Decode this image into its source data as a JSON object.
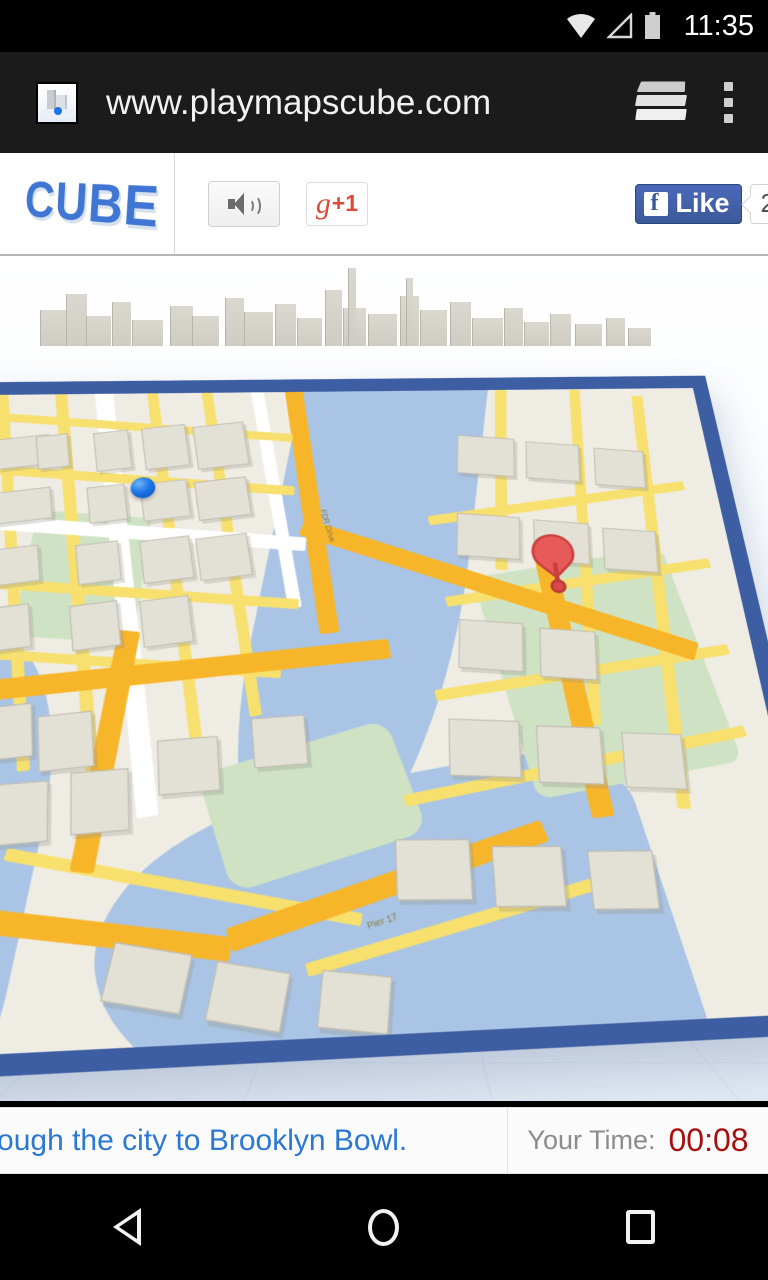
{
  "status_bar": {
    "time": "11:35",
    "icons": [
      "wifi-icon",
      "cellular-signal-icon",
      "battery-icon"
    ]
  },
  "browser": {
    "url": "www.playmapscube.com",
    "favicon": "maps-cube-favicon",
    "tabs_icon": "tabs-stack-icon",
    "menu_icon": "overflow-menu-icon"
  },
  "site_header": {
    "logo": "CUBE",
    "sound_button": {
      "icon": "speaker-icon",
      "label": ""
    },
    "gplus_button": {
      "g": "g",
      "plus_one": "+1"
    },
    "facebook": {
      "like_label": "Like",
      "count": "2"
    }
  },
  "game": {
    "player": "blue-ball",
    "destination": "red-map-pin",
    "roll_button": "roll-left-arrow",
    "street_labels": [
      "FDR Drive",
      "Pier 17"
    ],
    "colors": {
      "cube_frame": "#3e5ea3",
      "water": "#a9c4e4",
      "park": "#cfe3c4",
      "street": "#f7e06e",
      "highway": "#f7b529",
      "building": "#e3e0d6",
      "player": "#1a73e8",
      "pin": "#e8595a"
    }
  },
  "status_strip": {
    "mission_text": "Roll through the city to Brooklyn Bowl.",
    "time_label": "Your Time:",
    "time_value": "00:08"
  },
  "nav_bar": {
    "back": "back-icon",
    "home": "home-icon",
    "recents": "recents-icon"
  }
}
